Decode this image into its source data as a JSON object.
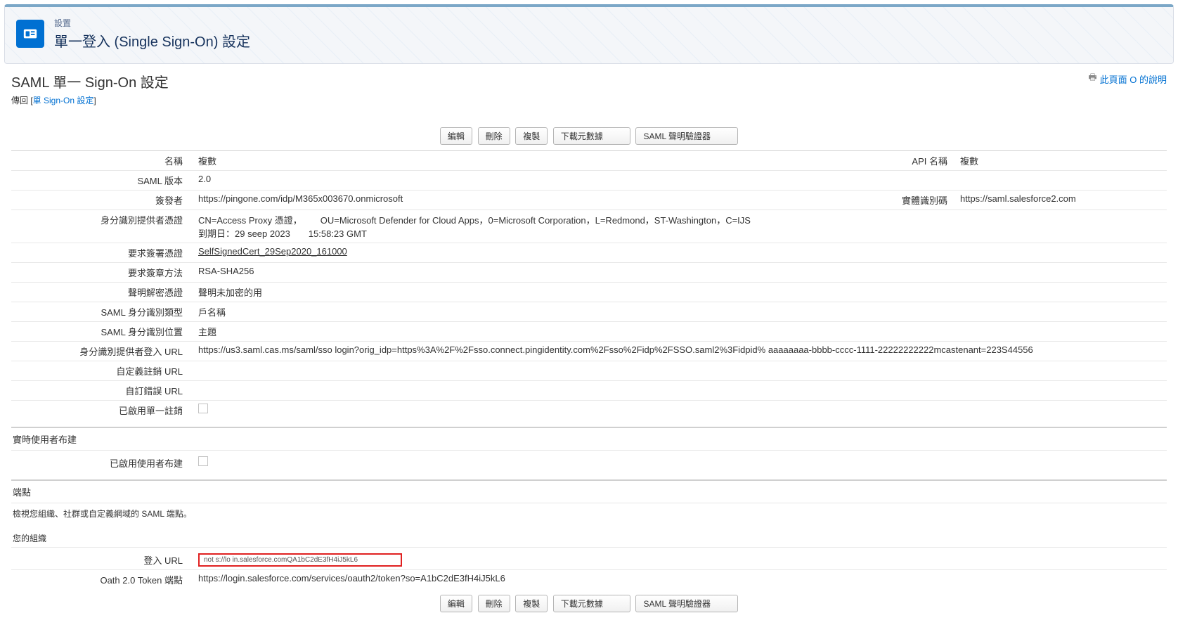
{
  "header": {
    "sup": "設置",
    "title": "單一登入 (Single Sign-On) 設定"
  },
  "page": {
    "title": "SAML 單一 Sign-On 設定",
    "help_link": "此頁面 О 的說明",
    "back_prefix": "傳回 [",
    "back_link": "單 Sign-On 設定",
    "back_suffix": "]"
  },
  "buttons": {
    "edit": "編輯",
    "delete": "刪除",
    "clone": "複製",
    "download_meta": "下載元數據",
    "saml_validator": "SAML 聲明驗證器"
  },
  "labels": {
    "name": "名稱",
    "api_name": "API 名稱",
    "saml_version": "SAML 版本",
    "issuer": "簽發者",
    "entity_id": "實體識別碼",
    "idp_cert": "身分識別提供者憑證",
    "req_sign_cert": "要求簽署憑證",
    "req_sign_method": "要求簽章方法",
    "assert_decrypt_cert": "聲明解密憑證",
    "saml_id_type": "SAML 身分識別類型",
    "saml_id_loc": "SAML 身分識別位置",
    "idp_login_url": "身分識別提供者登入 URL",
    "custom_logout_url": "自定義註銷 URL",
    "custom_error_url": "自訂錯誤 URL",
    "slo_enabled": "已啟用單一註銷",
    "jit_provisioning": "已啟用使用者布建",
    "login_url": "登入 URL",
    "oauth_endpoint": "Oath 2.0 Token 端點"
  },
  "values": {
    "name": "複數",
    "api_name": "複數",
    "saml_version": "2.0",
    "issuer": "https://pingone.com/idp/M365x003670.onmicrosoft",
    "entity_id": "https://saml.salesforce2.com",
    "idp_cert_line1": "CN=Access Proxy 憑證，  OU=Microsoft Defender for Cloud Apps，0=Microsoft Corporation，L=Redmond，ST-Washington，C=IJS",
    "idp_cert_line2": "到期日：29 seep 2023  15:58:23 GMT",
    "req_sign_cert": "SelfSignedCert_29Sep2020_161000",
    "req_sign_method": "RSA-SHA256",
    "assert_decrypt_cert": "聲明未加密的用",
    "saml_id_type": "戶名稱",
    "saml_id_loc": "主題",
    "idp_login_url": "https://us3.saml.cas.ms/saml/sso  login?orig_idp=https%3A%2F%2Fsso.connect.pingidentity.com%2Fsso%2Fidp%2FSSO.saml2%3Fidpid% aaaaaaaa-bbbb-cccc-1111-22222222222mcastenant=223S44556",
    "login_url": "not s://lo in.salesforce.comQA1bC2dE3fH4iJ5kL6",
    "oauth_endpoint": "https://login.salesforce.com/services/oauth2/token?so=A1bC2dE3fH4iJ5kL6"
  },
  "sections": {
    "jit_header": "實時使用者布建",
    "endpoints_header": "端點",
    "endpoints_desc": "檢視您組織、社群或自定義網域的 SAML 端點。",
    "your_org": "您的組織"
  }
}
